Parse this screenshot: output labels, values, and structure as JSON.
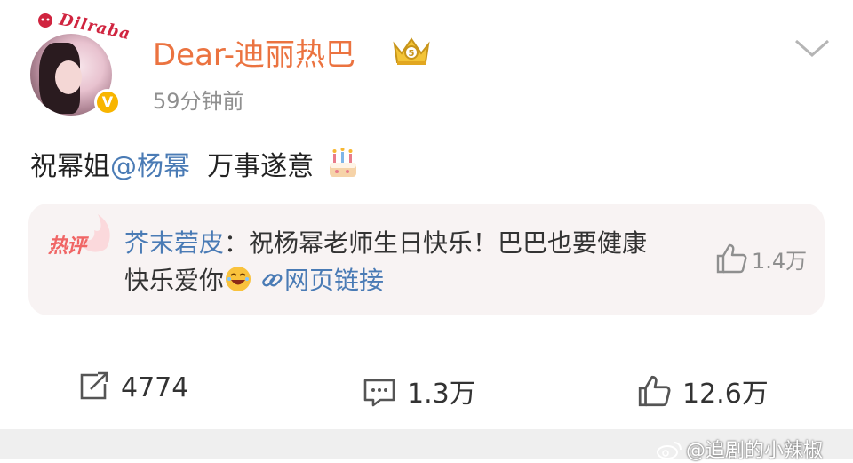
{
  "post": {
    "username": "Dear-迪丽热巴",
    "timestamp": "59分钟前",
    "avatar_badge_text": "Dilraba",
    "content": {
      "prefix": "祝幂姐",
      "mention": "@杨幂",
      "suffix": "万事遂意"
    }
  },
  "hot_comment": {
    "badge": "热评",
    "user": "芥末菪皮",
    "text": "：祝杨幂老师生日快乐！巴巴也要健康快乐爱你",
    "link_label": "网页链接",
    "likes": "1.4万"
  },
  "actions": {
    "reposts": "4774",
    "comments": "1.3万",
    "likes": "12.6万"
  },
  "watermark": "@追剧的小辣椒",
  "colors": {
    "username": "#eb7340",
    "mention": "#4a7bb5",
    "hot_badge": "#f06565",
    "verified": "#f8b500"
  },
  "icons": {
    "verified": "verified-v-icon",
    "crown": "crown-icon",
    "more": "chevron-down-icon",
    "cake": "birthday-cake-emoji",
    "laugh": "laughing-emoji",
    "link": "link-icon",
    "repost": "repost-icon",
    "comment": "comment-icon",
    "like": "thumbs-up-icon"
  }
}
